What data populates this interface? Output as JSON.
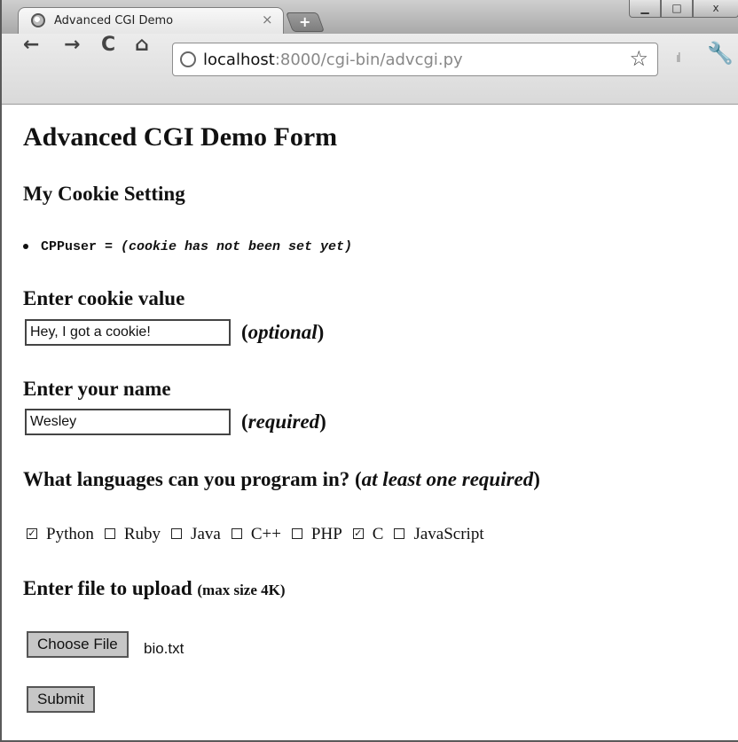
{
  "browser": {
    "tab_title": "Advanced CGI Demo",
    "tab_close": "×",
    "new_tab": "+",
    "window_buttons": {
      "minimize": "▁",
      "maximize": "□",
      "close": "x"
    },
    "url_host": "localhost",
    "url_path": ":8000/cgi-bin/advcgi.py",
    "nav": {
      "back": "←",
      "forward": "→",
      "reload": "C",
      "home": "⌂"
    },
    "star": "☆",
    "signal": "ıl",
    "wrench": "🔧"
  },
  "page": {
    "title": "Advanced CGI Demo Form",
    "cookie_heading": "My Cookie Setting",
    "cookie_name": "CPPuser = ",
    "cookie_value": "(cookie has not been set yet)",
    "cookie_input_heading": "Enter cookie value",
    "cookie_input_value": "Hey, I got a cookie!",
    "cookie_note_word": "optional",
    "name_heading": "Enter your name",
    "name_input_value": "Wesley",
    "name_note_word": "required",
    "languages_heading": "What languages can you program in? (",
    "languages_heading_em": "at least one required",
    "languages": [
      {
        "label": "Python",
        "checked": true
      },
      {
        "label": "Ruby",
        "checked": false
      },
      {
        "label": "Java",
        "checked": false
      },
      {
        "label": "C++",
        "checked": false
      },
      {
        "label": "PHP",
        "checked": false
      },
      {
        "label": "C",
        "checked": true
      },
      {
        "label": "JavaScript",
        "checked": false
      }
    ],
    "upload_heading": "Enter file to upload",
    "upload_note": "(max size 4K)",
    "choose_file_label": "Choose File",
    "file_name": "bio.txt",
    "submit_label": "Submit"
  }
}
